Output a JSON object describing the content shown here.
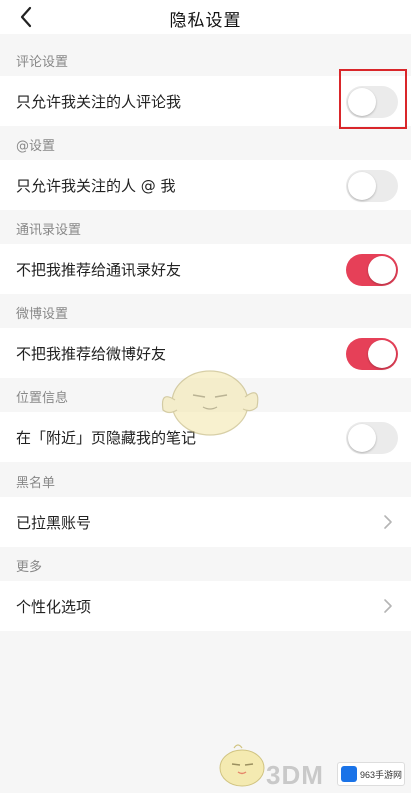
{
  "nav": {
    "title": "隐私设置",
    "back_icon": "chevron-left-icon"
  },
  "sections": [
    {
      "header": "评论设置",
      "rows": [
        {
          "label": "只允许我关注的人评论我",
          "control": "toggle",
          "on": false
        }
      ]
    },
    {
      "header": "@设置",
      "rows": [
        {
          "label": "只允许我关注的人 @ 我",
          "control": "toggle",
          "on": false
        }
      ]
    },
    {
      "header": "通讯录设置",
      "rows": [
        {
          "label": "不把我推荐给通讯录好友",
          "control": "toggle",
          "on": true
        }
      ]
    },
    {
      "header": "微博设置",
      "rows": [
        {
          "label": "不把我推荐给微博好友",
          "control": "toggle",
          "on": true
        }
      ]
    },
    {
      "header": "位置信息",
      "rows": [
        {
          "label": "在「附近」页隐藏我的笔记",
          "control": "toggle",
          "on": false
        }
      ]
    },
    {
      "header": "黑名单",
      "rows": [
        {
          "label": "已拉黑账号",
          "control": "chevron"
        }
      ]
    },
    {
      "header": "更多",
      "rows": [
        {
          "label": "个性化选项",
          "control": "chevron"
        }
      ]
    }
  ],
  "colors": {
    "toggle_on": "#e64058",
    "toggle_off": "#ebebeb",
    "highlight": "#d9262a"
  },
  "watermark": {
    "brand": "3DM",
    "site": "963手游网"
  }
}
